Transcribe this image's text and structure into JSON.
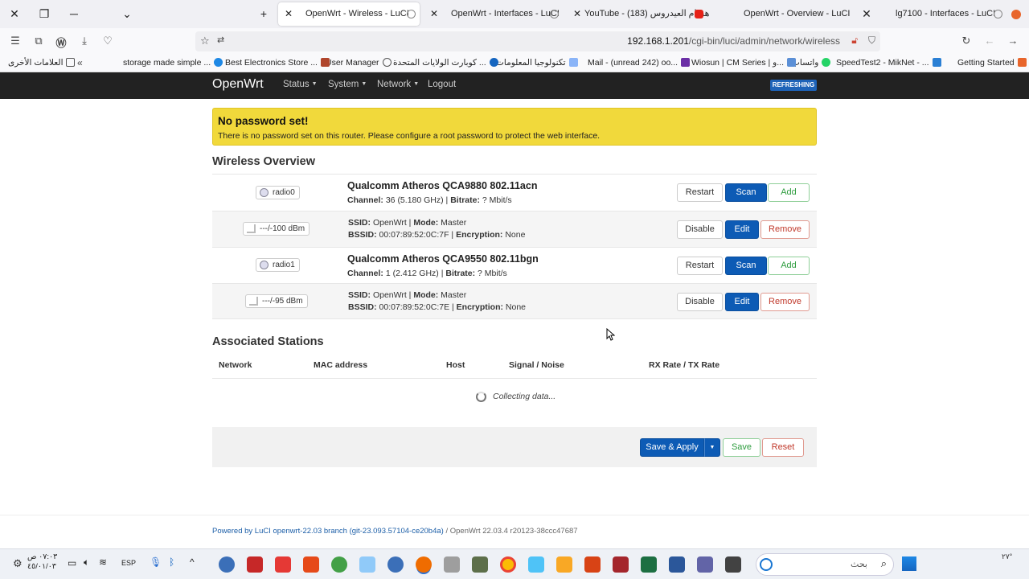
{
  "browser": {
    "tabs": [
      {
        "title": "OpenWrt - Wireless - LuCI",
        "active": true
      },
      {
        "title": "OpenWrt - Interfaces - LuCI",
        "active": false
      },
      {
        "title": "YouTube - هشام العيدروس (183)",
        "active": false
      },
      {
        "title": "OpenWrt - Overview - LuCI",
        "active": false
      },
      {
        "title": "lg7100 - Interfaces - LuCI",
        "active": false
      }
    ],
    "url_host": "192.168.1.201",
    "url_path": "/cgi-bin/luci/admin/network/wireless",
    "bookmarks": [
      "Getting Started",
      "SpeedTest2 - MikNet - ...",
      "واتساب",
      "Wiosun | CM Series | و...",
      "Mail - (unread 242) oo...",
      "تكنولوجيا المعلومات",
      "كوبارت الولايات المتحدة ...",
      "User Manager",
      "Best Electronics Store ...",
      "storage made simple ...",
      "العلامات الأخرى"
    ]
  },
  "header": {
    "brand": "OpenWrt",
    "menu": [
      "Status",
      "System",
      "Network",
      "Logout"
    ],
    "refreshing": "REFRESHING"
  },
  "alert": {
    "title": "No password set!",
    "text": "There is no password set on this router. Please configure a root password to protect the web interface."
  },
  "wireless": {
    "heading": "Wireless Overview",
    "radios": [
      {
        "badge": "radio0",
        "name": "Qualcomm Atheros QCA9880 802.11acn",
        "channel_label": "Channel:",
        "channel": "36 (5.180 GHz)",
        "bitrate_label": "Bitrate:",
        "bitrate": "? Mbit/s",
        "buttons": [
          "Restart",
          "Scan",
          "Add"
        ],
        "net": {
          "signal": "---/-100 dBm",
          "ssid_label": "SSID:",
          "ssid": "OpenWrt",
          "mode_label": "Mode:",
          "mode": "Master",
          "bssid_label": "BSSID:",
          "bssid": "00:07:89:52:0C:7F",
          "enc_label": "Encryption:",
          "enc": "None",
          "buttons": [
            "Disable",
            "Edit",
            "Remove"
          ]
        }
      },
      {
        "badge": "radio1",
        "name": "Qualcomm Atheros QCA9550 802.11bgn",
        "channel_label": "Channel:",
        "channel": "1 (2.412 GHz)",
        "bitrate_label": "Bitrate:",
        "bitrate": "? Mbit/s",
        "buttons": [
          "Restart",
          "Scan",
          "Add"
        ],
        "net": {
          "signal": "---/-95 dBm",
          "ssid_label": "SSID:",
          "ssid": "OpenWrt",
          "mode_label": "Mode:",
          "mode": "Master",
          "bssid_label": "BSSID:",
          "bssid": "00:07:89:52:0C:7E",
          "enc_label": "Encryption:",
          "enc": "None",
          "buttons": [
            "Disable",
            "Edit",
            "Remove"
          ]
        }
      }
    ]
  },
  "stations": {
    "heading": "Associated Stations",
    "columns": [
      "Network",
      "MAC address",
      "Host",
      "Signal / Noise",
      "RX Rate / TX Rate"
    ],
    "loading": "Collecting data..."
  },
  "actions": {
    "save_apply": "Save & Apply",
    "save": "Save",
    "reset": "Reset"
  },
  "footer": {
    "link": "Powered by LuCI openwrt-22.03 branch (git-23.093.57104-ce20b4a)",
    "version": "/ OpenWrt 22.03.4 r20123-38ccc47687"
  },
  "taskbar": {
    "time": "٠٧:٠٣ ص",
    "date": "٤٥/٠١/٠٣",
    "lang": "ESP",
    "search_placeholder": "بحث",
    "temp": "٢٧°"
  },
  "colors": {
    "header_bg": "#222222",
    "alert_bg": "#f1d93b",
    "primary": "#0d5bb5"
  }
}
